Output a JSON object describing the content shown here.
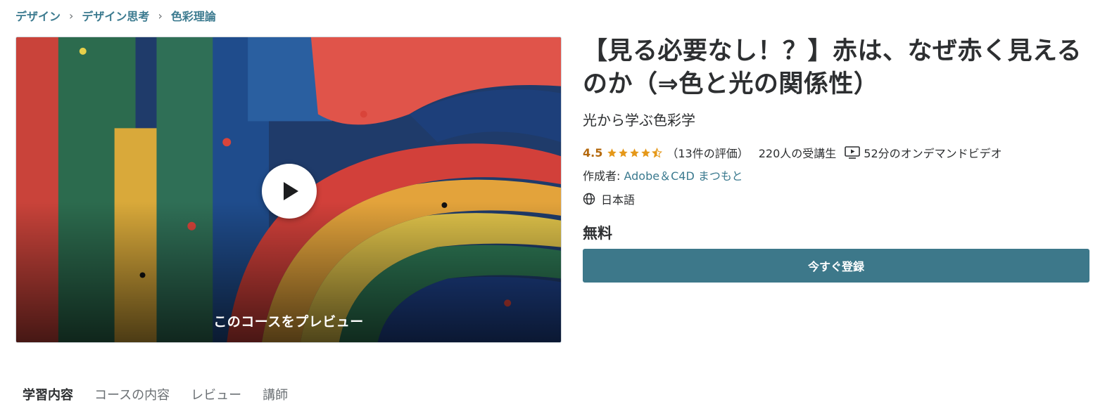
{
  "breadcrumb": {
    "items": [
      "デザイン",
      "デザイン思考",
      "色彩理論"
    ],
    "separator": "›"
  },
  "preview": {
    "label": "このコースをプレビュー"
  },
  "course": {
    "title": "【見る必要なし！？】赤は、なぜ赤く見えるのか（⇒色と光の関係性）",
    "subtitle": "光から学ぶ色彩学",
    "rating_value": "4.5",
    "stars": 4.5,
    "rating_count": "（13件の評価）",
    "students": "220人の受講生",
    "video": "52分のオンデマンドビデオ",
    "author_label": "作成者: ",
    "author_name": "Adobe＆C4D まつもと",
    "language": "日本語",
    "price": "無料",
    "enroll_label": "今すぐ登録"
  },
  "tabs": [
    "学習内容",
    "コースの内容",
    "レビュー",
    "講師"
  ],
  "colors": {
    "link": "#3b7a8f",
    "rating": "#b4690e",
    "button": "#3d788a",
    "text": "#2d2f31"
  },
  "icons": {
    "breadcrumb_separator": "chevron-right-icon",
    "play": "play-icon",
    "star": "star-icon",
    "video": "video-icon",
    "language": "globe-icon"
  }
}
